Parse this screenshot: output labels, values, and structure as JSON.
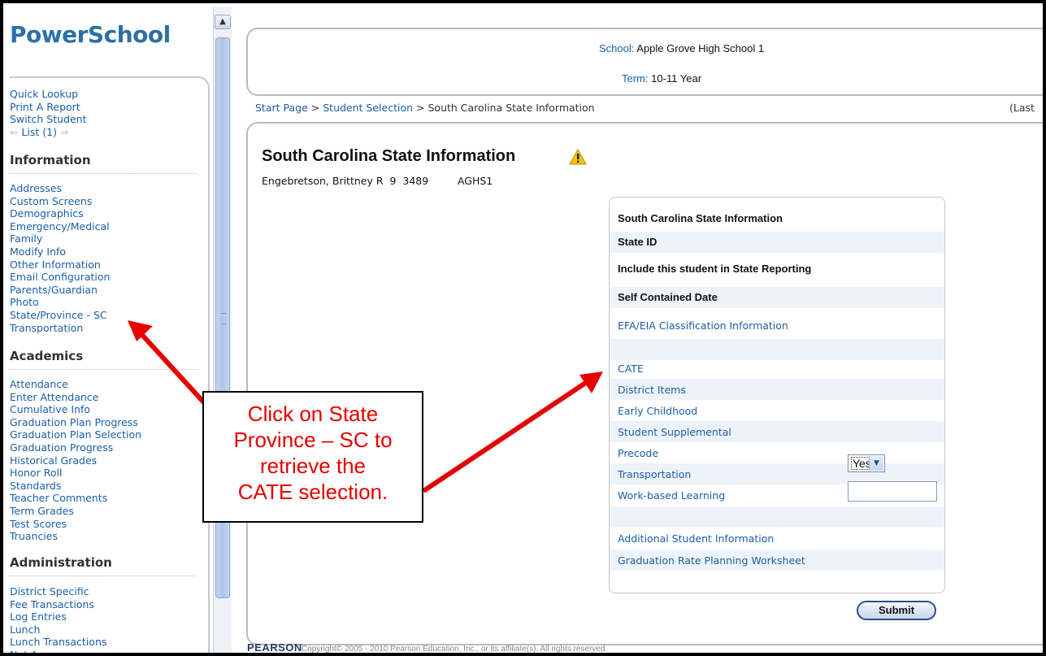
{
  "sidebar": {
    "logo": "PowerSchool",
    "top_links": [
      "Quick Lookup",
      "Print A Report",
      "Switch Student"
    ],
    "list_nav": "List (1)",
    "sections": [
      {
        "heading": "Information",
        "items": [
          "Addresses",
          "Custom Screens",
          "Demographics",
          "Emergency/Medical",
          "Family",
          "Modify Info",
          "Other Information",
          "Email Configuration",
          "Parents/Guardian",
          "Photo",
          "State/Province - SC",
          "Transportation"
        ]
      },
      {
        "heading": "Academics",
        "items": [
          "Attendance",
          "Enter Attendance",
          "Cumulative Info",
          "Graduation Plan Progress",
          "Graduation Plan Selection",
          "Graduation Progress",
          "Historical Grades",
          "Honor Roll",
          "Standards",
          "Teacher Comments",
          "Term Grades",
          "Test Scores",
          "Truancies"
        ]
      },
      {
        "heading": "Administration",
        "items": [
          "District Specific",
          "Fee Transactions",
          "Log Entries",
          "Lunch",
          "Lunch Transactions",
          "Net Access"
        ]
      }
    ]
  },
  "header": {
    "school_label": "School:",
    "school_value": "Apple Grove High School 1",
    "term_label": "Term:",
    "term_value": "10-11 Year"
  },
  "breadcrumb": {
    "start": "Start Page",
    "sep": ">",
    "selection": "Student Selection",
    "current": "South Carolina State Information",
    "right_text": "(Last"
  },
  "page": {
    "title": "South Carolina State Information",
    "student_line": "Engebretson, Brittney R  9  3489         AGHS1"
  },
  "form": {
    "header": "South Carolina State Information",
    "state_id_label": "State ID",
    "include_label": "Include this student in State Reporting",
    "include_value": "Yes",
    "self_contained_label": "Self Contained Date",
    "self_contained_value": "",
    "links": [
      "EFA/EIA Classification Information",
      "CATE",
      "District Items",
      "Early Childhood",
      "Student Supplemental",
      "Precode",
      "Transportation",
      "Work-based Learning",
      "Additional Student Information",
      "Graduation Rate Planning Worksheet"
    ],
    "submit_label": "Submit"
  },
  "footer": {
    "brand": "PEARSON",
    "copyright": "Copyright© 2005 - 2010 Pearson Education, Inc., or its affiliate(s). All rights reserved."
  },
  "callout": {
    "lines": [
      "Click on State",
      "Province – SC to",
      "retrieve the",
      "CATE selection."
    ],
    "color": "#e60000"
  }
}
